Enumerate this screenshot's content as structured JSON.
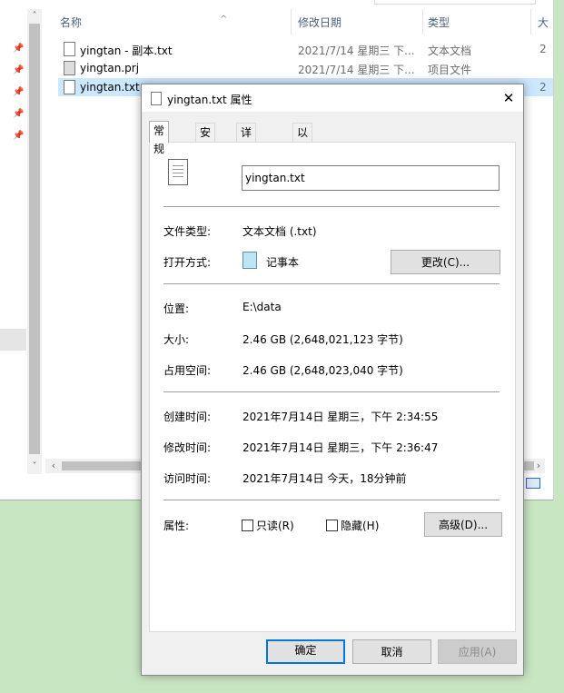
{
  "explorer": {
    "columns": {
      "name": "名称",
      "date": "修改日期",
      "type": "类型",
      "size": "大"
    },
    "files": [
      {
        "name": "yingtan - 副本.txt",
        "date": "2021/7/14 星期三 下...",
        "type": "文本文档",
        "size": "2"
      },
      {
        "name": "yingtan.prj",
        "date": "2021/7/14 星期三 下...",
        "type": "项目文件",
        "size": ""
      },
      {
        "name": "yingtan.txt",
        "date": "",
        "type": "",
        "size": "2"
      }
    ]
  },
  "dialog": {
    "title": "yingtan.txt 属性",
    "close": "✕",
    "tabs": [
      "常规",
      "安全",
      "详细信息",
      "以前的版本"
    ],
    "filename": "yingtan.txt",
    "fields": {
      "type_label": "文件类型:",
      "type_value": "文本文档 (.txt)",
      "open_label": "打开方式:",
      "open_value": "记事本",
      "change_button": "更改(C)...",
      "location_label": "位置:",
      "location_value": "E:\\data",
      "size_label": "大小:",
      "size_value": "2.46 GB (2,648,021,123 字节)",
      "disk_label": "占用空间:",
      "disk_value": "2.46 GB (2,648,023,040 字节)",
      "created_label": "创建时间:",
      "created_value": "2021年7月14日 星期三，下午 2:34:55",
      "modified_label": "修改时间:",
      "modified_value": "2021年7月14日 星期三，下午 2:36:47",
      "accessed_label": "访问时间:",
      "accessed_value": "2021年7月14日 今天，18分钟前",
      "attr_label": "属性:",
      "readonly_label": "只读(R)",
      "hidden_label": "隐藏(H)",
      "advanced_button": "高级(D)..."
    },
    "buttons": {
      "ok": "确定",
      "cancel": "取消",
      "apply": "应用(A)"
    }
  }
}
